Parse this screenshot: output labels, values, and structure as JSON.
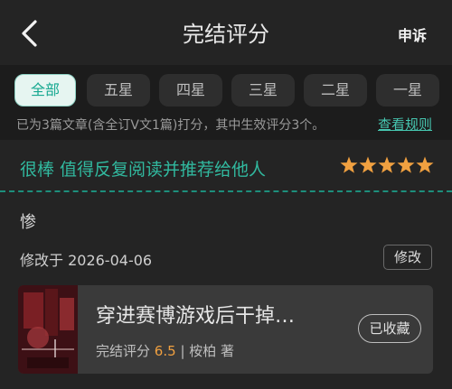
{
  "header": {
    "title": "完结评分",
    "appeal_label": "申诉"
  },
  "filters": [
    {
      "label": "全部",
      "active": true
    },
    {
      "label": "五星",
      "active": false
    },
    {
      "label": "四星",
      "active": false
    },
    {
      "label": "三星",
      "active": false
    },
    {
      "label": "二星",
      "active": false
    },
    {
      "label": "一星",
      "active": false
    }
  ],
  "summary": {
    "text": "已为3篇文章(含全订V文1篇)打分，其中生效评分3个。",
    "rules_link": "查看规则"
  },
  "rating": {
    "tagline": "很棒 值得反复阅读并推荐给他人",
    "stars": 5,
    "review_text": "惨",
    "modified_text": "修改于 2026-04-06",
    "edit_label": "修改"
  },
  "book": {
    "title": "穿进赛博游戏后干掉…",
    "score_label": "完结评分",
    "score": "6.5",
    "author_text": "| 桉柏 著",
    "collect_label": "已收藏"
  },
  "colors": {
    "accent": "#31b99f",
    "star": "#f0a040",
    "background": "#1c1c1c"
  }
}
